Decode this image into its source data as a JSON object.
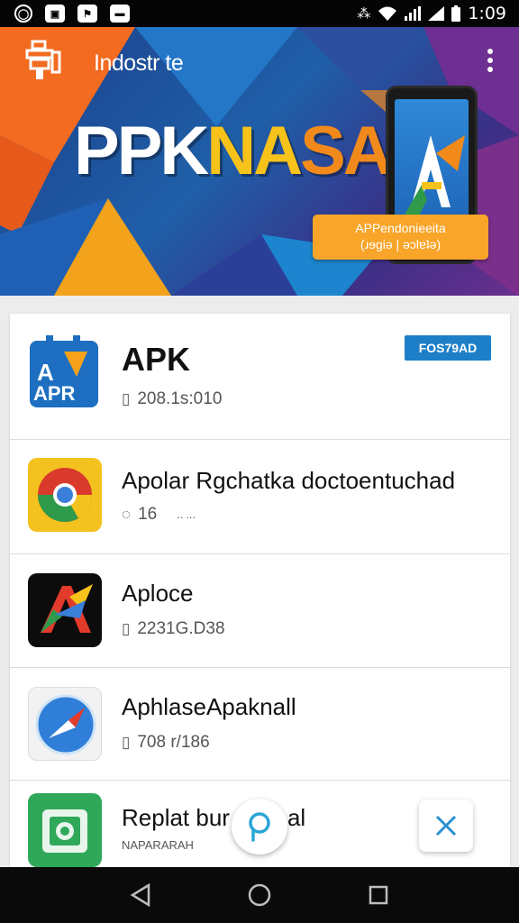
{
  "status_bar": {
    "time": "1:09",
    "left_icons": [
      "whatsapp-icon",
      "gallery-icon",
      "flag-icon",
      "message-icon"
    ],
    "right_icons": [
      "vibrate-icon",
      "wifi-icon",
      "signal-icon",
      "signal-icon",
      "battery-icon"
    ]
  },
  "header": {
    "app_title": "Indostr te",
    "hero_text": {
      "part1": "PPK",
      "part2": "NA",
      "part3": "SA"
    },
    "badge_line1": "APPendonieeita",
    "badge_line2": "(ɹɘgiə | əɔlɐʇə)",
    "menu_icon": "overflow-menu-icon"
  },
  "apps": [
    {
      "title": "APK",
      "meta": "208.1s:010",
      "meta_icon": "file-icon",
      "badge": "FOS79AD",
      "icon": "apk-logo-icon"
    },
    {
      "title": "Apolar Rgchatka doctoentuchad",
      "meta": "16",
      "meta_extra": "‥ .‥",
      "meta_icon": "comment-icon",
      "icon": "chrome-icon"
    },
    {
      "title": "Aploce",
      "meta": "2231G.D38",
      "meta_icon": "file-icon",
      "icon": "a-logo-icon"
    },
    {
      "title": "AphlaseApaknall",
      "meta": "708 r/186",
      "meta_icon": "file-icon",
      "icon": "compass-icon"
    },
    {
      "title": "Replat bur",
      "title_tail": "al",
      "meta": "NAPARARAH",
      "icon": "camera-app-icon"
    }
  ],
  "colors": {
    "accent_blue": "#1d7fc8",
    "accent_orange": "#f8a52a",
    "accent_yellow": "#f7c21a",
    "fab_icon": "#2aa6d6"
  },
  "fabs": {
    "search_icon": "search-icon",
    "close_icon": "close-icon"
  },
  "nav_bar": {
    "icons": [
      "back-icon",
      "home-icon",
      "recents-icon"
    ]
  }
}
